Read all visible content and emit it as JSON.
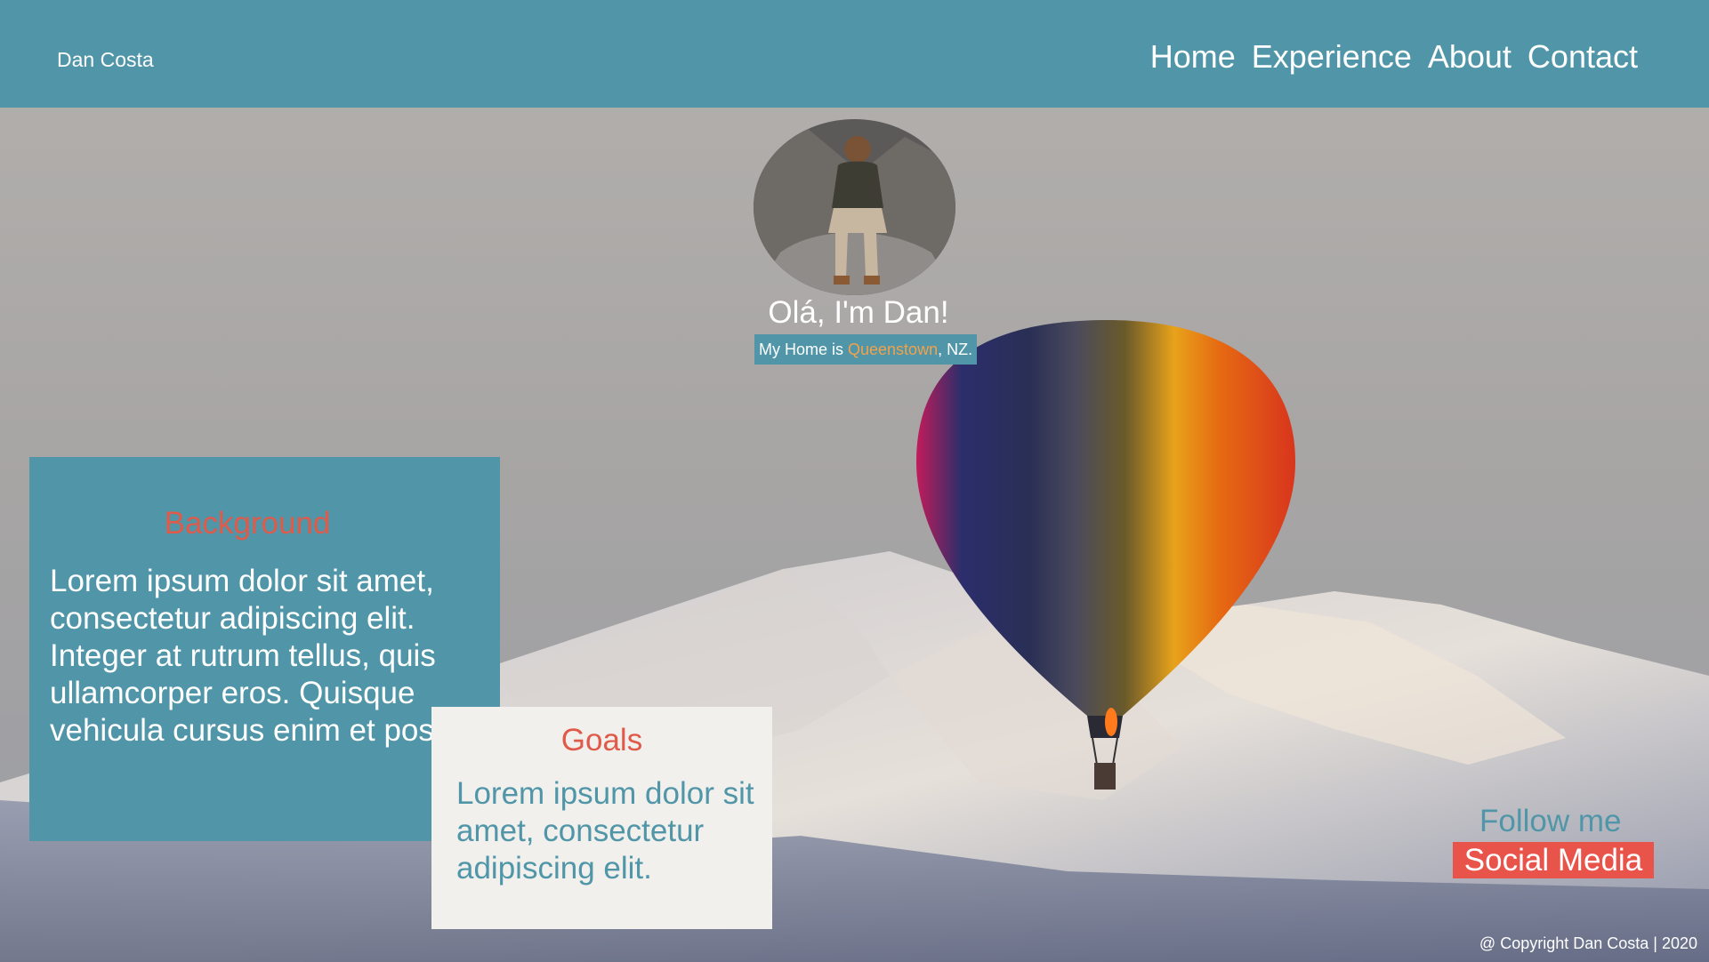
{
  "header": {
    "brand": "Dan Costa",
    "nav": [
      "Home",
      "Experience",
      "About",
      "Contact"
    ]
  },
  "hero": {
    "greeting": "Olá, I'm Dan!",
    "home_prefix": "My Home is ",
    "home_city": "Queenstown",
    "home_suffix": ", NZ."
  },
  "background_card": {
    "title": "Background",
    "body": "Lorem ipsum dolor sit amet, consectetur adipiscing elit. Integer at rutrum tellus, quis ullamcorper eros. Quisque vehicula cursus enim et posuere."
  },
  "goals_card": {
    "title": "Goals",
    "body": "Lorem ipsum dolor sit amet, consectetur adipiscing elit."
  },
  "social": {
    "follow": "Follow me",
    "button": "Social Media"
  },
  "footer": {
    "copyright": "@ Copyright Dan Costa | 2020"
  },
  "colors": {
    "accent": "#5096a8",
    "highlight": "#e05a4a",
    "city": "#f2a24b"
  }
}
